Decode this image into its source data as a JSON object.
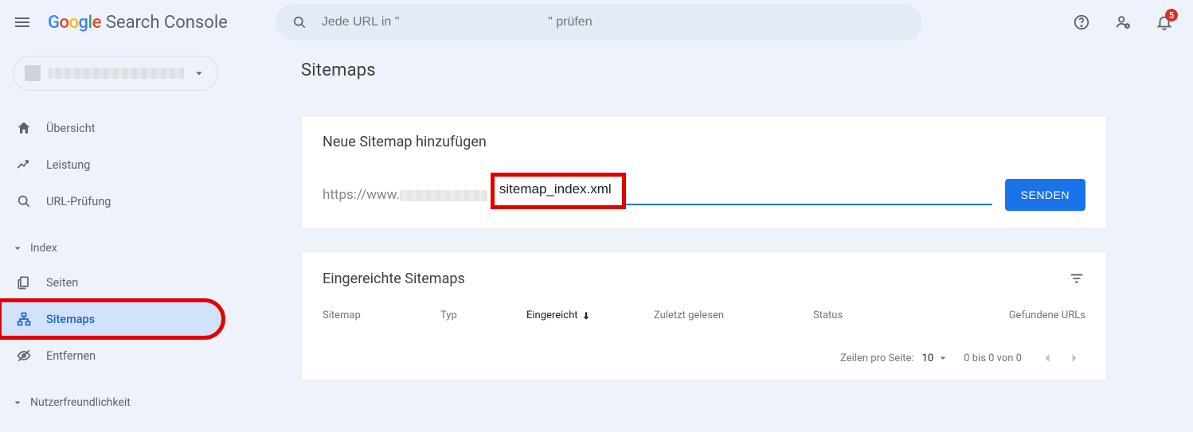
{
  "header": {
    "product_name": "Search Console",
    "search_placeholder": "Jede URL in \"                                          \" prüfen",
    "notification_count": "5"
  },
  "sidebar": {
    "items": [
      {
        "label": "Übersicht"
      },
      {
        "label": "Leistung"
      },
      {
        "label": "URL-Prüfung"
      }
    ],
    "group_index": "Index",
    "index_items": [
      {
        "label": "Seiten"
      },
      {
        "label": "Sitemaps"
      },
      {
        "label": "Entfernen"
      }
    ],
    "group_ux": "Nutzerfreundlichkeit"
  },
  "main": {
    "page_title": "Sitemaps",
    "add_card": {
      "title": "Neue Sitemap hinzufügen",
      "url_prefix": "https://www.",
      "input_value": "sitemap_index.xml",
      "send_label": "SENDEN"
    },
    "list_card": {
      "title": "Eingereichte Sitemaps",
      "columns": {
        "sitemap": "Sitemap",
        "typ": "Typ",
        "eingereicht": "Eingereicht",
        "zuletzt": "Zuletzt gelesen",
        "status": "Status",
        "urls": "Gefundene URLs"
      },
      "rows_per_page_label": "Zeilen pro Seite:",
      "rows_per_page_value": "10",
      "range_text": "0 bis 0 von 0"
    }
  }
}
